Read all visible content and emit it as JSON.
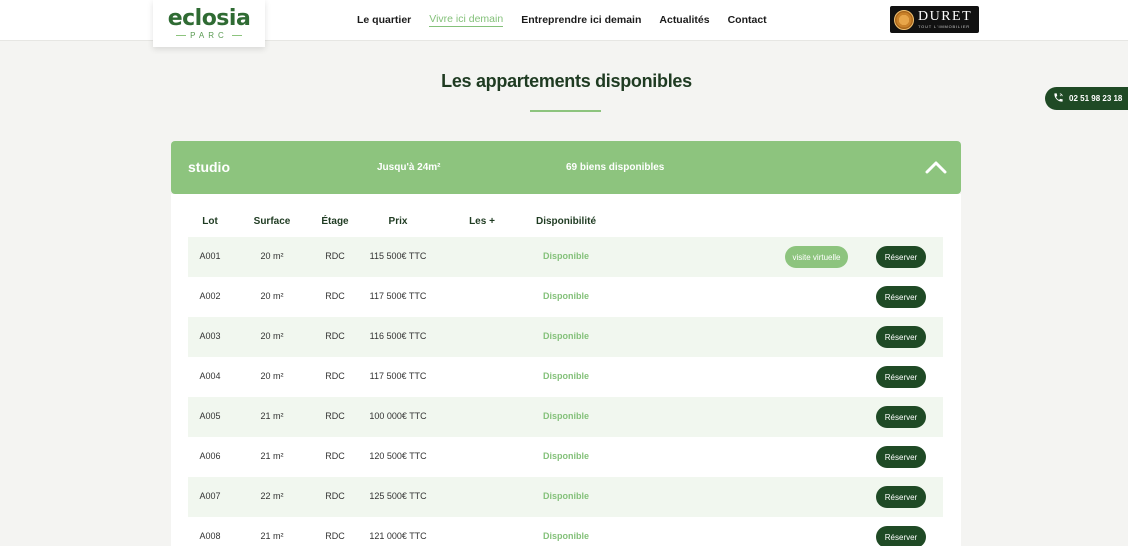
{
  "header": {
    "logo": {
      "main": "eclosia",
      "sub": "PARC"
    },
    "nav": [
      {
        "label": "Le quartier",
        "active": false
      },
      {
        "label": "Vivre ici demain",
        "active": true
      },
      {
        "label": "Entreprendre ici demain",
        "active": false
      },
      {
        "label": "Actualités",
        "active": false
      },
      {
        "label": "Contact",
        "active": false
      }
    ],
    "partner_logo": {
      "name": "DURET",
      "tagline": "TOUT L'IMMOBILIER"
    }
  },
  "phone": {
    "number": "02 51 98 23 18",
    "icon": "phone-icon"
  },
  "page_title": "Les appartements disponibles",
  "accordion": {
    "type": "studio",
    "surface": "Jusqu'à 24m²",
    "count": "69 biens disponibles",
    "expanded": true
  },
  "table": {
    "columns": [
      "Lot",
      "Surface",
      "Étage",
      "Prix",
      "Les +",
      "Disponibilité"
    ],
    "virtual_label": "visite virtuelle",
    "reserve_label": "Réserver",
    "rows": [
      {
        "lot": "A001",
        "surface": "20 m²",
        "etage": "RDC",
        "prix": "115 500€ TTC",
        "dispo": "Disponible",
        "virtual": true
      },
      {
        "lot": "A002",
        "surface": "20 m²",
        "etage": "RDC",
        "prix": "117 500€ TTC",
        "dispo": "Disponible",
        "virtual": false
      },
      {
        "lot": "A003",
        "surface": "20 m²",
        "etage": "RDC",
        "prix": "116 500€ TTC",
        "dispo": "Disponible",
        "virtual": false
      },
      {
        "lot": "A004",
        "surface": "20 m²",
        "etage": "RDC",
        "prix": "117 500€ TTC",
        "dispo": "Disponible",
        "virtual": false
      },
      {
        "lot": "A005",
        "surface": "21 m²",
        "etage": "RDC",
        "prix": "100 000€ TTC",
        "dispo": "Disponible",
        "virtual": false
      },
      {
        "lot": "A006",
        "surface": "21 m²",
        "etage": "RDC",
        "prix": "120 500€ TTC",
        "dispo": "Disponible",
        "virtual": false
      },
      {
        "lot": "A007",
        "surface": "22 m²",
        "etage": "RDC",
        "prix": "125 500€ TTC",
        "dispo": "Disponible",
        "virtual": false
      },
      {
        "lot": "A008",
        "surface": "21 m²",
        "etage": "RDC",
        "prix": "121 000€ TTC",
        "dispo": "Disponible",
        "virtual": false
      }
    ]
  },
  "colors": {
    "brand_green": "#8dc47e",
    "dark_green": "#1f4a25",
    "row_alt": "#f1f7ef",
    "page_bg": "#f4f4f2"
  }
}
